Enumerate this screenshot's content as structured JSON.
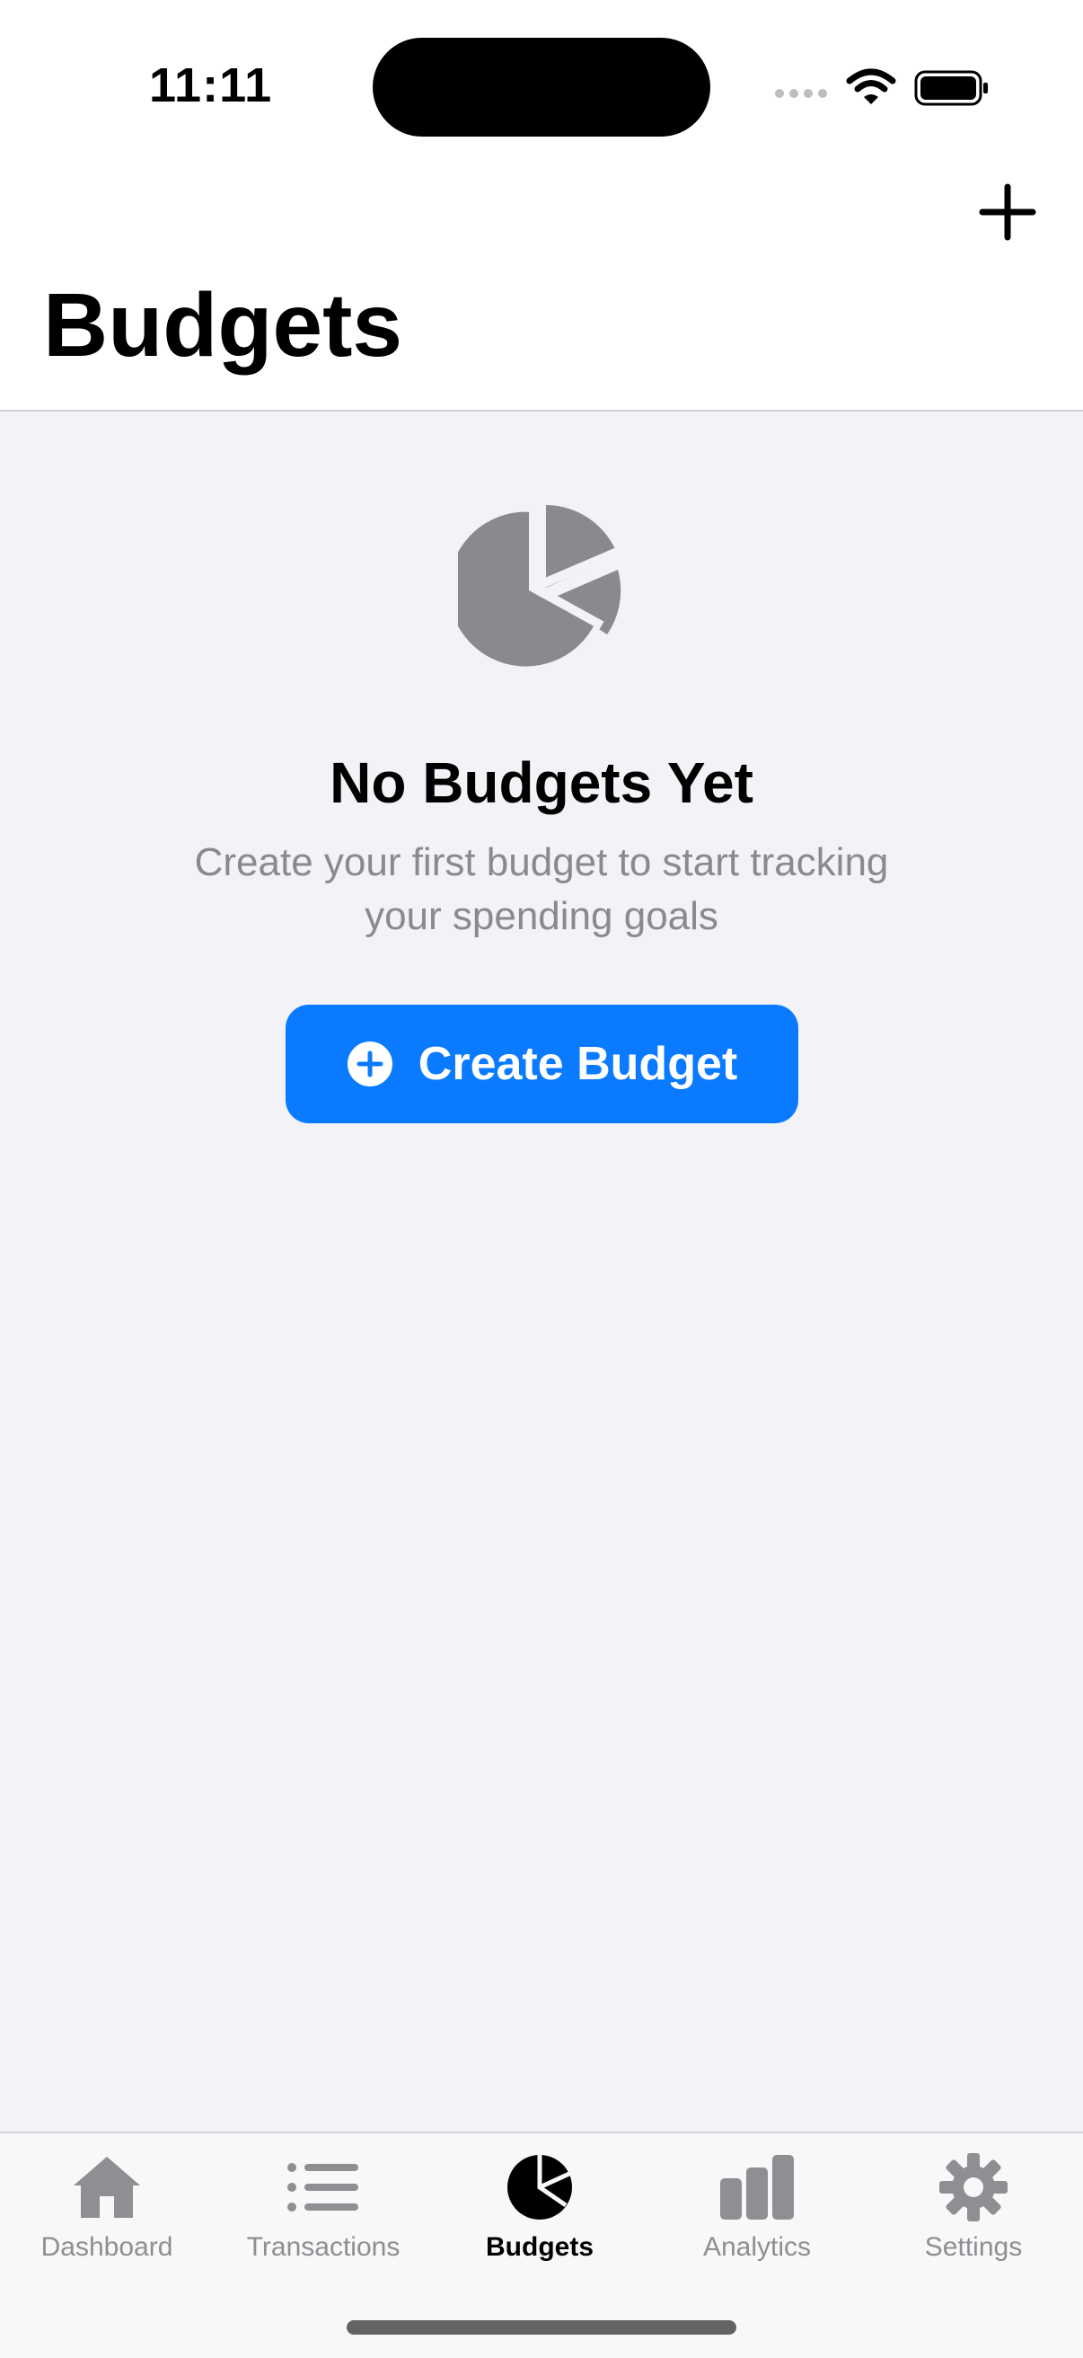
{
  "status_bar": {
    "time": "11:11",
    "signal_icon": "signal-dots-icon",
    "wifi_icon": "wifi-icon",
    "battery_icon": "battery-icon"
  },
  "nav": {
    "title": "Budgets",
    "add_icon": "plus-icon"
  },
  "empty_state": {
    "icon": "pie-chart-icon",
    "title": "No Budgets Yet",
    "subtitle_line1": "Create your first budget to start tracking",
    "subtitle_line2": "your spending goals",
    "button_label": "Create Budget",
    "button_icon": "plus-circle-icon"
  },
  "tabs": [
    {
      "label": "Dashboard",
      "icon": "house-icon",
      "active": false
    },
    {
      "label": "Transactions",
      "icon": "list-icon",
      "active": false
    },
    {
      "label": "Budgets",
      "icon": "pie-chart-icon",
      "active": true
    },
    {
      "label": "Analytics",
      "icon": "bar-chart-icon",
      "active": false
    },
    {
      "label": "Settings",
      "icon": "gear-icon",
      "active": false
    }
  ],
  "colors": {
    "accent": "#0a7aff",
    "background": "#f2f2f7",
    "icon_gray": "#8a8a8e",
    "tab_inactive": "#8e8e93",
    "tab_active": "#000000"
  }
}
